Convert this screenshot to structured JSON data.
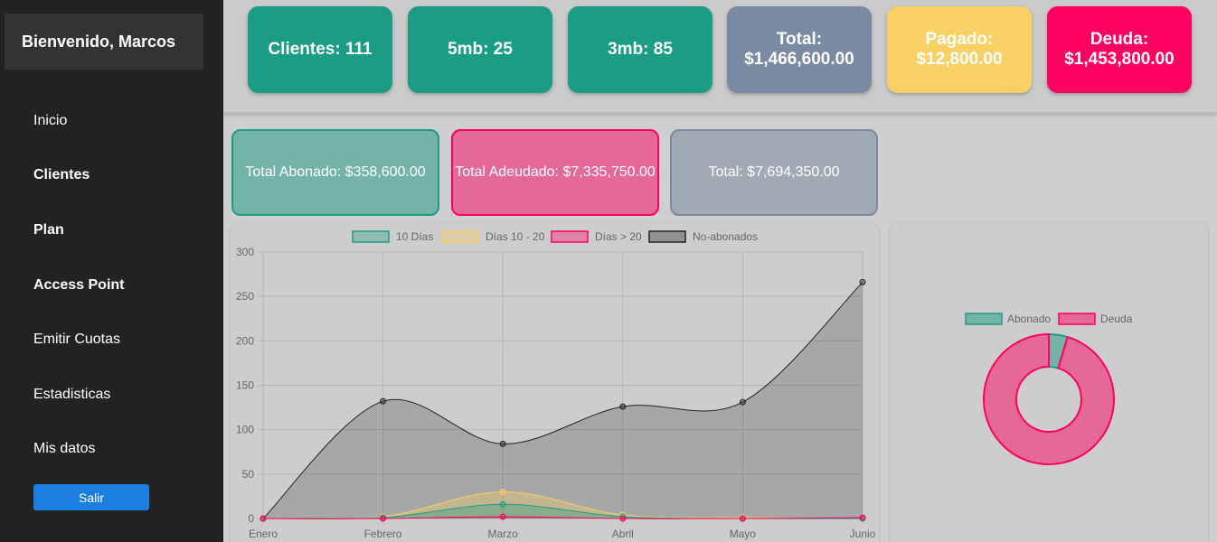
{
  "sidebar": {
    "welcome": "Bienvenido, Marcos",
    "items": [
      "Inicio",
      "Clientes",
      "Plan",
      "Access Point",
      "Emitir Cuotas",
      "Estadisticas",
      "Mis datos"
    ],
    "logout_label": "Salir"
  },
  "stats": [
    {
      "line1": "Clientes: 111",
      "line2": "",
      "color": "#1b9d85"
    },
    {
      "line1": "5mb: 25",
      "line2": "",
      "color": "#1b9d85"
    },
    {
      "line1": "3mb: 85",
      "line2": "",
      "color": "#1b9d85"
    },
    {
      "line1": "Total:",
      "line2": "$1,466,600.00",
      "color": "#7a8aa2"
    },
    {
      "line1": "Pagado:",
      "line2": "$12,800.00",
      "color": "#f8d063"
    },
    {
      "line1": "Deuda:",
      "line2": "$1,453,800.00",
      "color": "#fe0060"
    }
  ],
  "summary": [
    {
      "label": "Total Abonado: $358,600.00",
      "bg": "#74b4a8",
      "border": "#1b9d85"
    },
    {
      "label": "Total Adeudado: $7,335,750.00",
      "bg": "#e46996",
      "border": "#fe0060"
    },
    {
      "label": "Total: $7,694,350.00",
      "bg": "#a0a9b4",
      "border": "#7a8aa2"
    }
  ],
  "chart_data": [
    {
      "type": "area",
      "categories": [
        "Enero",
        "Febrero",
        "Marzo",
        "Abril",
        "Mayo",
        "Junio"
      ],
      "ylim": [
        0,
        300
      ],
      "yticks": [
        "0",
        "50",
        "100",
        "150",
        "200",
        "250",
        "300"
      ],
      "grid": true,
      "legend_position": "top",
      "series": [
        {
          "name": "10 Días",
          "values": [
            0,
            1,
            16,
            2,
            0,
            0
          ],
          "color": "#1b9d85"
        },
        {
          "name": "Días 10 - 20",
          "values": [
            0,
            2,
            30,
            4,
            1,
            0
          ],
          "color": "#f8d063"
        },
        {
          "name": "Días > 20",
          "values": [
            0,
            0,
            2,
            0,
            0,
            1
          ],
          "color": "#fe0060"
        },
        {
          "name": "No-abonados",
          "values": [
            0,
            132,
            84,
            126,
            131,
            266
          ],
          "color": "#222222"
        }
      ]
    },
    {
      "type": "pie",
      "legend_position": "top",
      "labels": [
        "Abonado",
        "Deuda"
      ],
      "values": [
        358600,
        7335750
      ],
      "colors": [
        "#74b4a8",
        "#e46996"
      ],
      "borders": [
        "#1b9d85",
        "#fe0060"
      ]
    }
  ]
}
